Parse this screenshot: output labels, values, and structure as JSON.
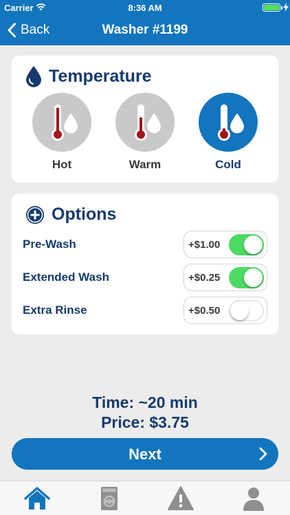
{
  "status": {
    "carrier": "Carrier",
    "time": "8:36 AM",
    "battery_level": 1.0
  },
  "nav": {
    "back_label": "Back",
    "title": "Washer #1199"
  },
  "temperature": {
    "title": "Temperature",
    "options": [
      {
        "label": "Hot",
        "selected": false
      },
      {
        "label": "Warm",
        "selected": false
      },
      {
        "label": "Cold",
        "selected": true
      }
    ]
  },
  "options": {
    "title": "Options",
    "items": [
      {
        "label": "Pre-Wash",
        "price": "+$1.00",
        "enabled": true
      },
      {
        "label": "Extended Wash",
        "price": "+$0.25",
        "enabled": true
      },
      {
        "label": "Extra Rinse",
        "price": "+$0.50",
        "enabled": false
      }
    ]
  },
  "summary": {
    "time": "Time: ~20 min",
    "price": "Price: $3.75"
  },
  "next_button": {
    "label": "Next"
  },
  "tabs": [
    {
      "icon": "home-icon",
      "active": true
    },
    {
      "icon": "washer-icon",
      "active": false
    },
    {
      "icon": "warning-icon",
      "active": false
    },
    {
      "icon": "user-icon",
      "active": false
    }
  ],
  "colors": {
    "brand": "#1275bd",
    "navy": "#163a6e",
    "toggle_on": "#4cd964",
    "mercury": "#a3151f"
  }
}
